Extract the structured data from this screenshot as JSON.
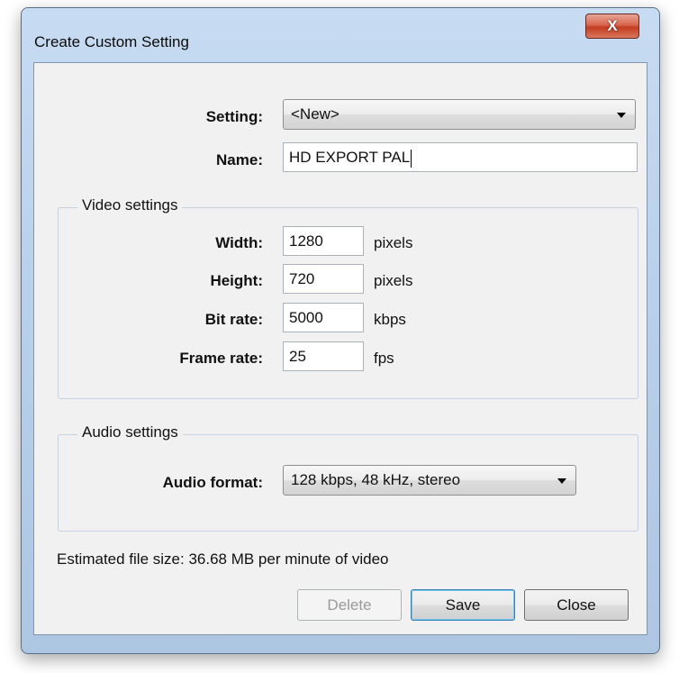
{
  "window": {
    "title": "Create Custom Setting",
    "close_glyph": "X"
  },
  "form": {
    "setting_label": "Setting:",
    "setting_value": "<New>",
    "name_label": "Name:",
    "name_value": "HD EXPORT PAL"
  },
  "video": {
    "group_title": "Video settings",
    "width_label": "Width:",
    "width_value": "1280",
    "width_unit": "pixels",
    "height_label": "Height:",
    "height_value": "720",
    "height_unit": "pixels",
    "bitrate_label": "Bit rate:",
    "bitrate_value": "5000",
    "bitrate_unit": "kbps",
    "framerate_label": "Frame rate:",
    "framerate_value": "25",
    "framerate_unit": "fps"
  },
  "audio": {
    "group_title": "Audio settings",
    "format_label": "Audio format:",
    "format_value": "128 kbps, 48 kHz, stereo"
  },
  "status": {
    "estimated_size": "Estimated file size: 36.68 MB per minute of video"
  },
  "buttons": {
    "delete": "Delete",
    "save": "Save",
    "close": "Close"
  }
}
